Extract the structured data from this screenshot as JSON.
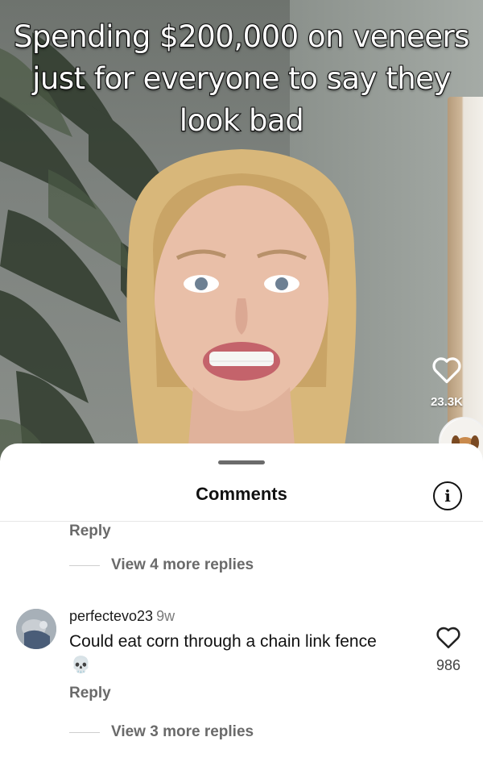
{
  "video": {
    "caption": "Spending $200,000 on veneers just for everyone to say they look bad",
    "like_count": "23.3K",
    "like_icon": "heart-outline-icon",
    "music_disc_icon": "dog-avatar-icon"
  },
  "sheet": {
    "title": "Comments",
    "info_icon": "info-icon",
    "info_glyph": "i"
  },
  "thread_1": {
    "reply_label": "Reply",
    "view_more_label": "View 4 more replies"
  },
  "comment": {
    "username": "perfectevo23",
    "time": "9w",
    "text": "Could eat corn through a chain link fence",
    "emoji": "💀",
    "reply_label": "Reply",
    "view_more_label": "View 3 more replies",
    "like_count": "986",
    "like_icon": "heart-outline-icon"
  },
  "colors": {
    "text_primary": "#111111",
    "text_secondary": "#6a6a6a",
    "sheet_bg": "#ffffff"
  }
}
